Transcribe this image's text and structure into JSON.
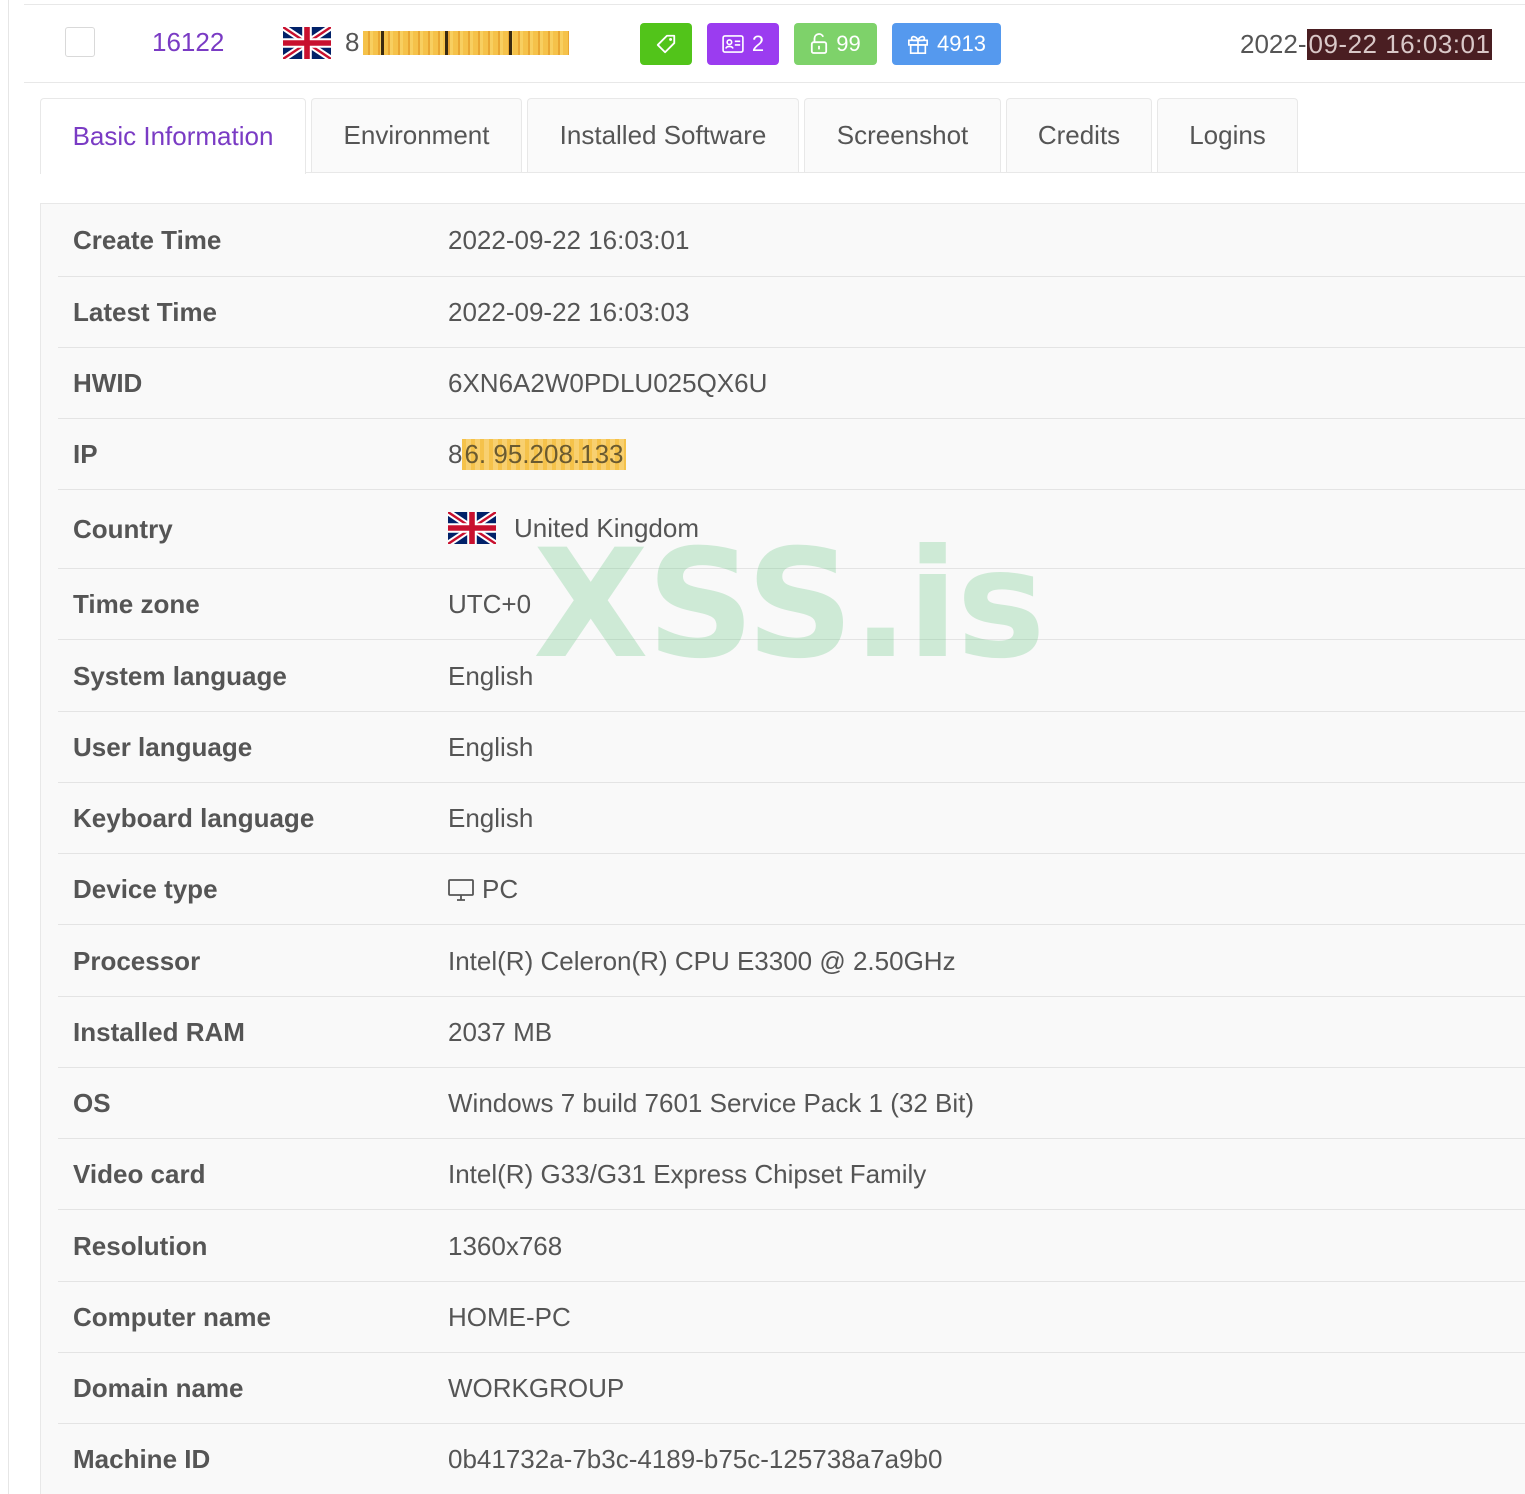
{
  "summary": {
    "log_id": "16122",
    "ip_prefix": "8",
    "badges": {
      "id_count": "2",
      "lock_count": "99",
      "gift_count": "4913"
    },
    "date_prefix": "2022-",
    "date_redacted": "09-22 16:03:01",
    "colors": {
      "tag": "#52c41a",
      "id": "#9b3cf0",
      "lock": "#7ed26a",
      "gift": "#5599ee",
      "accent": "#7a3bc4"
    }
  },
  "tabs": [
    {
      "label": "Basic Information",
      "active": true
    },
    {
      "label": "Environment"
    },
    {
      "label": "Installed Software"
    },
    {
      "label": "Screenshot"
    },
    {
      "label": "Credits"
    },
    {
      "label": "Logins"
    }
  ],
  "details": {
    "create_time": {
      "label": "Create Time",
      "value": "2022-09-22 16:03:01"
    },
    "latest_time": {
      "label": "Latest Time",
      "value": "2022-09-22 16:03:03"
    },
    "hwid": {
      "label": "HWID",
      "value": "6XN6A2W0PDLU025QX6U"
    },
    "ip": {
      "label": "IP",
      "value_prefix": "8",
      "value_redacted": "6. 95.208.133"
    },
    "country": {
      "label": "Country",
      "value": "United Kingdom",
      "flag_icon": "uk-flag-icon"
    },
    "time_zone": {
      "label": "Time zone",
      "value": "UTC+0"
    },
    "system_language": {
      "label": "System language",
      "value": "English"
    },
    "user_language": {
      "label": "User language",
      "value": "English"
    },
    "keyboard_language": {
      "label": "Keyboard language",
      "value": "English"
    },
    "device_type": {
      "label": "Device type",
      "value": "PC",
      "icon": "desktop-icon"
    },
    "processor": {
      "label": "Processor",
      "value": "Intel(R) Celeron(R) CPU E3300 @ 2.50GHz"
    },
    "installed_ram": {
      "label": "Installed RAM",
      "value": "2037 MB"
    },
    "os": {
      "label": "OS",
      "value": "Windows 7 build 7601 Service Pack 1 (32 Bit)"
    },
    "video_card": {
      "label": "Video card",
      "value": "Intel(R) G33/G31 Express Chipset Family"
    },
    "resolution": {
      "label": "Resolution",
      "value": "1360x768"
    },
    "computer_name": {
      "label": "Computer name",
      "value": "HOME-PC"
    },
    "domain_name": {
      "label": "Domain name",
      "value": "WORKGROUP"
    },
    "machine_id": {
      "label": "Machine ID",
      "value": "0b41732a-7b3c-4189-b75c-125738a7a9b0"
    }
  },
  "watermark": "XSS.is"
}
